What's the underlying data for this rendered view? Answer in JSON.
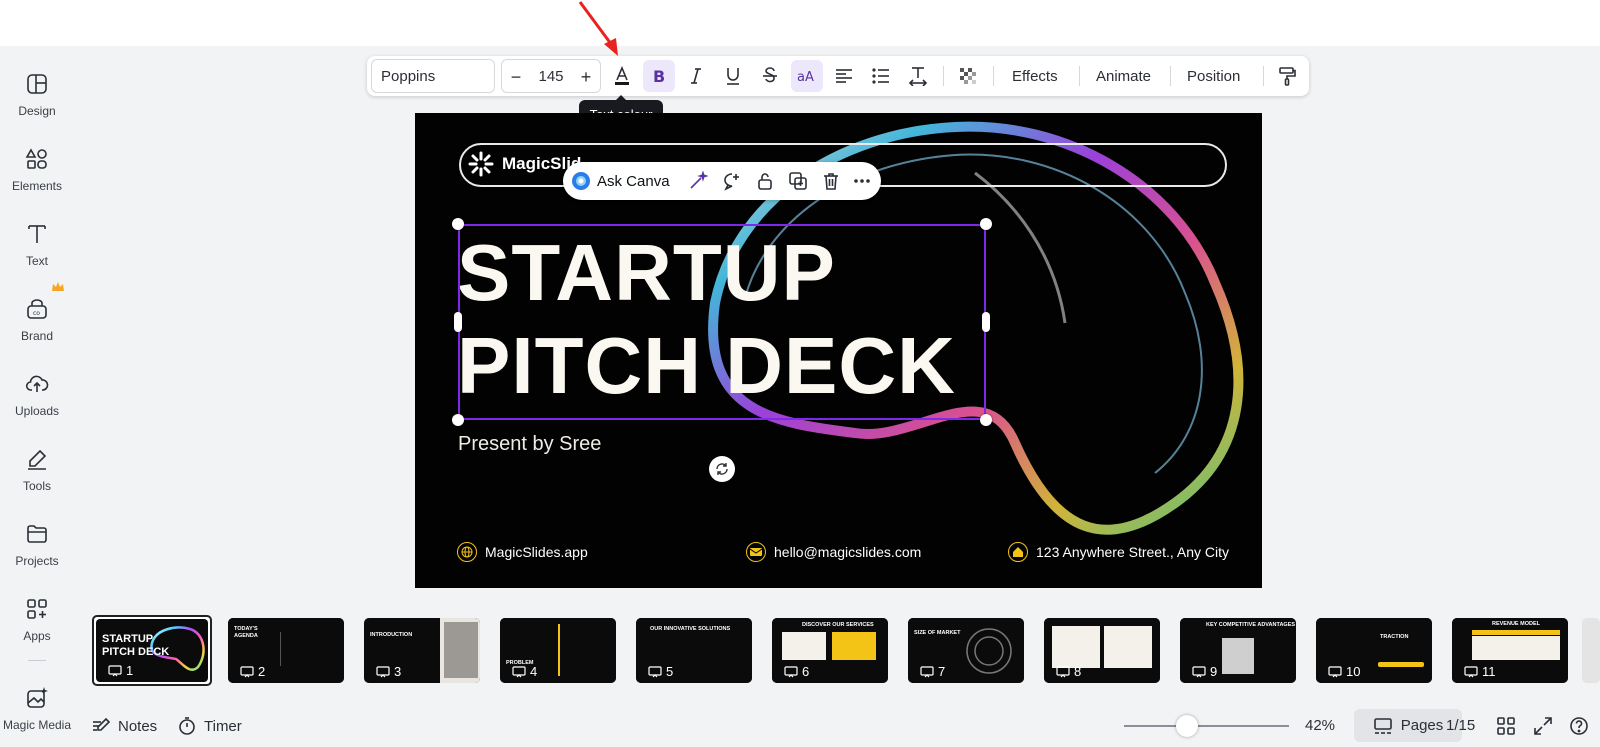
{
  "sidebar": {
    "items": [
      {
        "label": "Design",
        "icon": "design-icon"
      },
      {
        "label": "Elements",
        "icon": "elements-icon"
      },
      {
        "label": "Text",
        "icon": "text-icon"
      },
      {
        "label": "Brand",
        "icon": "brand-icon"
      },
      {
        "label": "Uploads",
        "icon": "uploads-icon"
      },
      {
        "label": "Tools",
        "icon": "tools-icon"
      },
      {
        "label": "Projects",
        "icon": "projects-icon"
      },
      {
        "label": "Apps",
        "icon": "apps-icon"
      },
      {
        "label": "Magic Media",
        "icon": "magic-media-icon"
      }
    ]
  },
  "toolbar": {
    "font_name": "Poppins",
    "font_size": "145",
    "decrease": "−",
    "increase": "+",
    "effects": "Effects",
    "animate": "Animate",
    "position": "Position"
  },
  "tooltip": {
    "text": "Text colour"
  },
  "float_bar": {
    "ask_canva": "Ask Canva"
  },
  "slide": {
    "brand": "MagicSlid",
    "title_line1": "STARTUP",
    "title_line2": "PITCH DECK",
    "subtitle": "Present by Sree",
    "footer": {
      "website": "MagicSlides.app",
      "email": "hello@magicslides.com",
      "address": "123 Anywhere Street., Any City"
    },
    "colors": {
      "background": "#020202",
      "text": "#fbf8f1",
      "accent": "#f3c316",
      "selection": "#7d2ae8"
    }
  },
  "thumbnails": [
    {
      "num": "1",
      "title": "STARTUP\nPITCH DECK",
      "selected": true
    },
    {
      "num": "2",
      "title": "TODAY'S\nAGENDA"
    },
    {
      "num": "3",
      "title": "INTRODUCTION"
    },
    {
      "num": "4",
      "title": "PROBLEM"
    },
    {
      "num": "5",
      "title": "OUR INNOVATIVE\nSOLUTIONS"
    },
    {
      "num": "6",
      "title": "DISCOVER OUR SERVICES"
    },
    {
      "num": "7",
      "title": "SIZE OF\nMARKET"
    },
    {
      "num": "8",
      "title": ""
    },
    {
      "num": "9",
      "title": "KEY COMPETITIVE\nADVANTAGES"
    },
    {
      "num": "10",
      "title": "TRACTION"
    },
    {
      "num": "11",
      "title": "REVENUE MODEL"
    }
  ],
  "bottom": {
    "notes": "Notes",
    "timer": "Timer",
    "zoom": "42%",
    "zoom_level": 0.42,
    "pages": "Pages",
    "page_count": "1/15"
  }
}
